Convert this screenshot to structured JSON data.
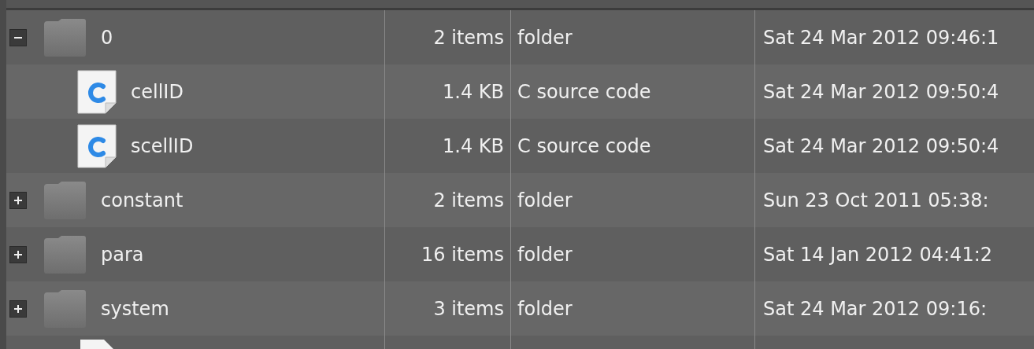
{
  "file_tree": {
    "rows": [
      {
        "kind": "folder",
        "name": "0",
        "size": "2 items",
        "type": "folder",
        "modified": "Sat 24 Mar 2012 09:46:1",
        "expanded": true,
        "children": [
          {
            "kind": "c_source",
            "name": "cellID",
            "size": "1.4 KB",
            "type": "C source code",
            "modified": "Sat 24 Mar 2012 09:50:4"
          },
          {
            "kind": "c_source",
            "name": "scellID",
            "size": "1.4 KB",
            "type": "C source code",
            "modified": "Sat 24 Mar 2012 09:50:4"
          }
        ]
      },
      {
        "kind": "folder",
        "name": "constant",
        "size": "2 items",
        "type": "folder",
        "modified": "Sun 23 Oct 2011 05:38:",
        "expanded": false
      },
      {
        "kind": "folder",
        "name": "para",
        "size": "16 items",
        "type": "folder",
        "modified": "Sat 14 Jan 2012 04:41:2",
        "expanded": false
      },
      {
        "kind": "folder",
        "name": "system",
        "size": "3 items",
        "type": "folder",
        "modified": "Sat 24 Mar 2012 09:16:",
        "expanded": false
      },
      {
        "kind": "file"
      }
    ]
  }
}
